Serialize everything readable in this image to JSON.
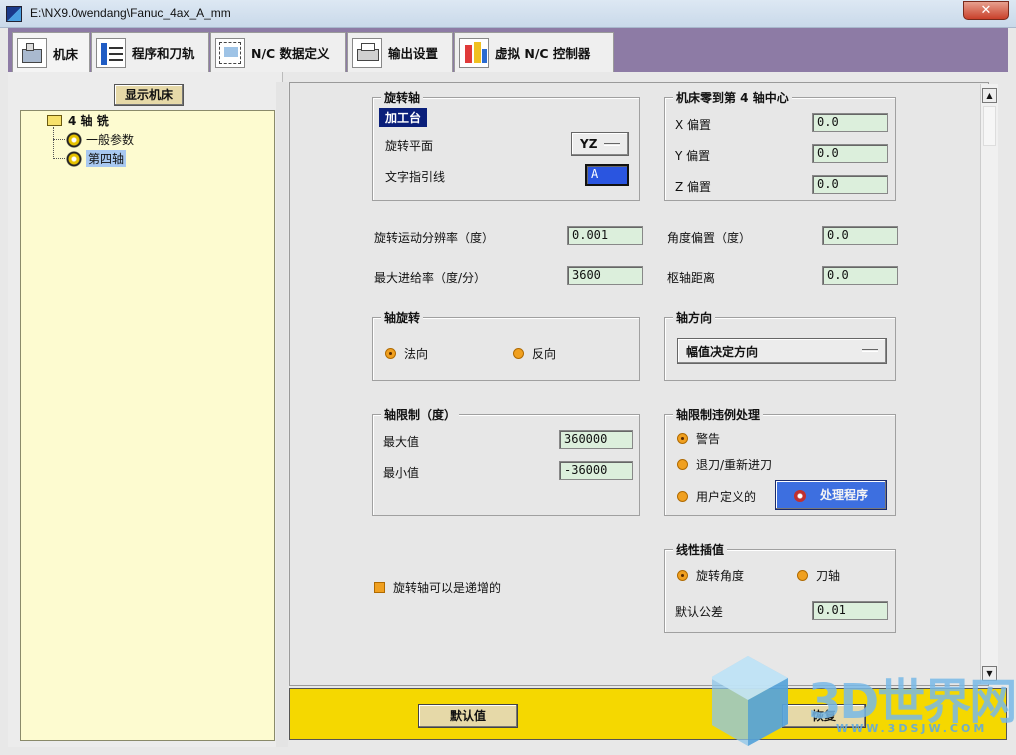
{
  "window": {
    "title": "E:\\NX9.0wendang\\Fanuc_4ax_A_mm",
    "close_glyph": "✕"
  },
  "tabs": [
    {
      "label": "机床",
      "icon": "machine-icon"
    },
    {
      "label": "程序和刀轨",
      "icon": "toolpath-icon"
    },
    {
      "label": "N/C 数据定义",
      "icon": "nc-data-icon"
    },
    {
      "label": "输出设置",
      "icon": "printer-icon"
    },
    {
      "label": "虚拟 N/C 控制器",
      "icon": "controller-icon"
    }
  ],
  "left": {
    "show_machine_label": "显示机床",
    "tree": {
      "root": "4 轴 铣",
      "children": [
        "一般参数",
        "第四轴"
      ],
      "selected": "第四轴"
    }
  },
  "rotary_axis": {
    "title": "旋转轴",
    "type_badge": "加工台",
    "plane_label": "旋转平面",
    "plane_value": "YZ",
    "leader_label": "文字指引线",
    "leader_value": "A"
  },
  "zero_to_center": {
    "title": "机床零到第 4 轴中心",
    "x_label": "X 偏置",
    "x_value": "0.0",
    "y_label": "Y 偏置",
    "y_value": "0.0",
    "z_label": "Z 偏置",
    "z_value": "0.0"
  },
  "params": {
    "resolution_label": "旋转运动分辨率（度）",
    "resolution_value": "0.001",
    "angle_offset_label": "角度偏置（度）",
    "angle_offset_value": "0.0",
    "feed_label": "最大进给率（度/分）",
    "feed_value": "3600",
    "pivot_label": "枢轴距离",
    "pivot_value": "0.0"
  },
  "axis_rotation": {
    "title": "轴旋转",
    "options": [
      "法向",
      "反向"
    ],
    "selected": "法向"
  },
  "axis_direction": {
    "title": "轴方向",
    "value": "幅值决定方向"
  },
  "axis_limits": {
    "title": "轴限制（度）",
    "max_label": "最大值",
    "max_value": "360000",
    "min_label": "最小值",
    "min_value": "-36000"
  },
  "limit_violation": {
    "title": "轴限制违例处理",
    "options": [
      "警告",
      "退刀/重新进刀",
      "用户定义的"
    ],
    "selected": "警告",
    "handler_button": "处理程序"
  },
  "incremental_checkbox": "旋转轴可以是递增的",
  "linear_interp": {
    "title": "线性插值",
    "options": [
      "旋转角度",
      "刀轴"
    ],
    "selected": "旋转角度",
    "tolerance_label": "默认公差",
    "tolerance_value": "0.01"
  },
  "footer": {
    "default_button": "默认值",
    "restore_button": "恢复"
  },
  "watermark": {
    "brand": "3D世界网",
    "url": "WWW.3DSJW.COM"
  },
  "colors": {
    "tab_strip": "#8d7ba5",
    "tree_bg": "#fdfbd0",
    "footer": "#f5d800",
    "field": "#dcefdc",
    "badge": "#0a1f7a"
  }
}
